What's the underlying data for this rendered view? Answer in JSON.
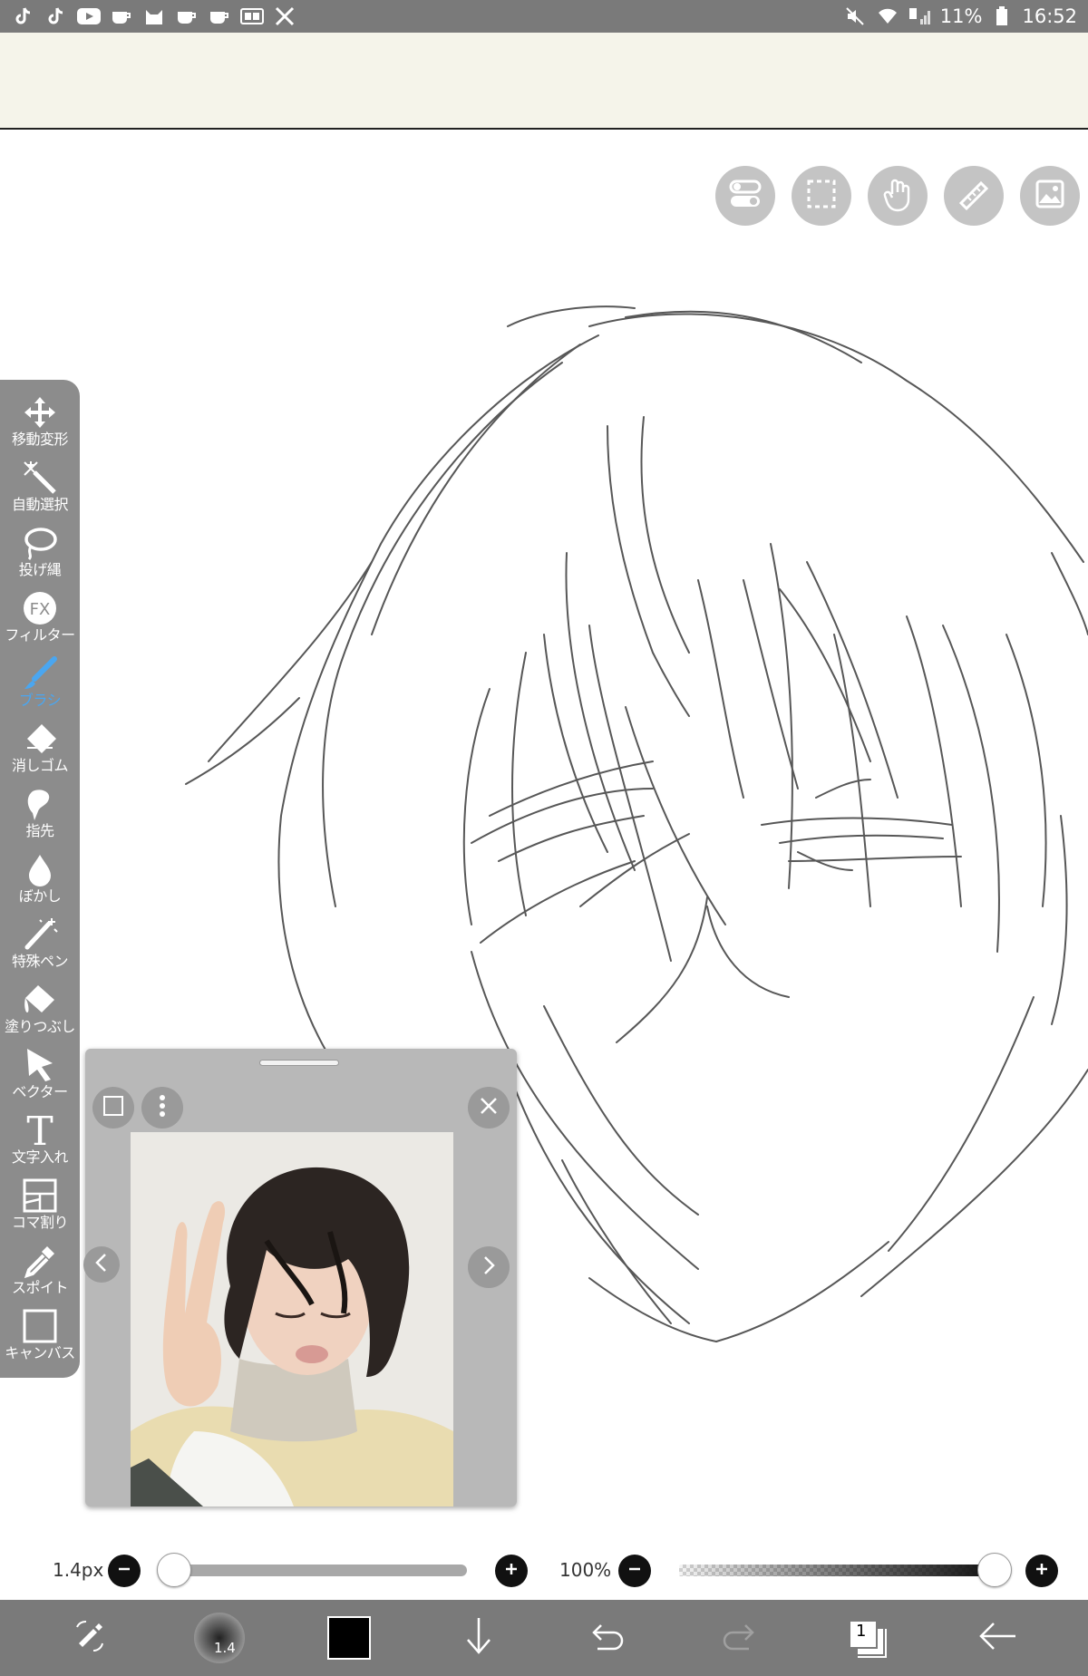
{
  "status_bar": {
    "battery_text": "11%",
    "time": "16:52",
    "left_icons": [
      "tiktok-icon",
      "tiktok-icon",
      "youtube-icon",
      "cup-icon",
      "cat-icon",
      "cup-icon",
      "cup-icon",
      "ge-icon",
      "tools-icon"
    ],
    "right_icons": [
      "mute-icon",
      "wifi-icon",
      "signal-icon",
      "battery-icon"
    ]
  },
  "top_buttons": [
    "toggle-icon",
    "selection-icon",
    "hand-icon",
    "ruler-icon",
    "image-icon"
  ],
  "toolbar": {
    "items": [
      {
        "icon": "move-transform-icon",
        "label": "移動変形",
        "active": false
      },
      {
        "icon": "magic-wand-icon",
        "label": "自動選択",
        "active": false
      },
      {
        "icon": "lasso-icon",
        "label": "投げ縄",
        "active": false
      },
      {
        "icon": "fx-icon",
        "label": "フィルター",
        "active": false
      },
      {
        "icon": "brush-icon",
        "label": "ブラシ",
        "active": true
      },
      {
        "icon": "eraser-icon",
        "label": "消しゴム",
        "active": false
      },
      {
        "icon": "finger-icon",
        "label": "指先",
        "active": false
      },
      {
        "icon": "blur-drop-icon",
        "label": "ぼかし",
        "active": false
      },
      {
        "icon": "special-pen-icon",
        "label": "特殊ペン",
        "active": false
      },
      {
        "icon": "fill-icon",
        "label": "塗りつぶし",
        "active": false
      },
      {
        "icon": "vector-icon",
        "label": "ベクター",
        "active": false
      },
      {
        "icon": "text-icon",
        "label": "文字入れ",
        "active": false
      },
      {
        "icon": "frame-divider-icon",
        "label": "コマ割り",
        "active": false
      },
      {
        "icon": "eyedropper-icon",
        "label": "スポイト",
        "active": false
      },
      {
        "icon": "canvas-icon",
        "label": "キャンバス",
        "active": false
      }
    ],
    "fx_text": "FX",
    "text_tool_glyph": "T"
  },
  "reference_window": {
    "buttons": [
      "square-icon",
      "more-vertical-icon",
      "close-icon",
      "prev-arrow-icon",
      "next-arrow-icon"
    ]
  },
  "brush_size": {
    "label": "1.4px",
    "value_fraction": 0.0
  },
  "opacity": {
    "label": "100%",
    "value_fraction": 1.0
  },
  "bottom_bar": {
    "brush_preview_text": "1.4",
    "layer_count": "1",
    "primary_color": "#000000",
    "items": [
      "swap-tools-icon",
      "brush-preview",
      "color-swatch",
      "download-arrow-icon",
      "undo-icon",
      "redo-icon",
      "layers-icon",
      "back-arrow-icon"
    ]
  },
  "colors": {
    "status_bar": "#7a7a7a",
    "top_panel": "#f5f4ea",
    "toolbar": "#8c8c8c",
    "active_tool": "#4aa6f0",
    "bottom_bar": "#7a7a7a"
  }
}
